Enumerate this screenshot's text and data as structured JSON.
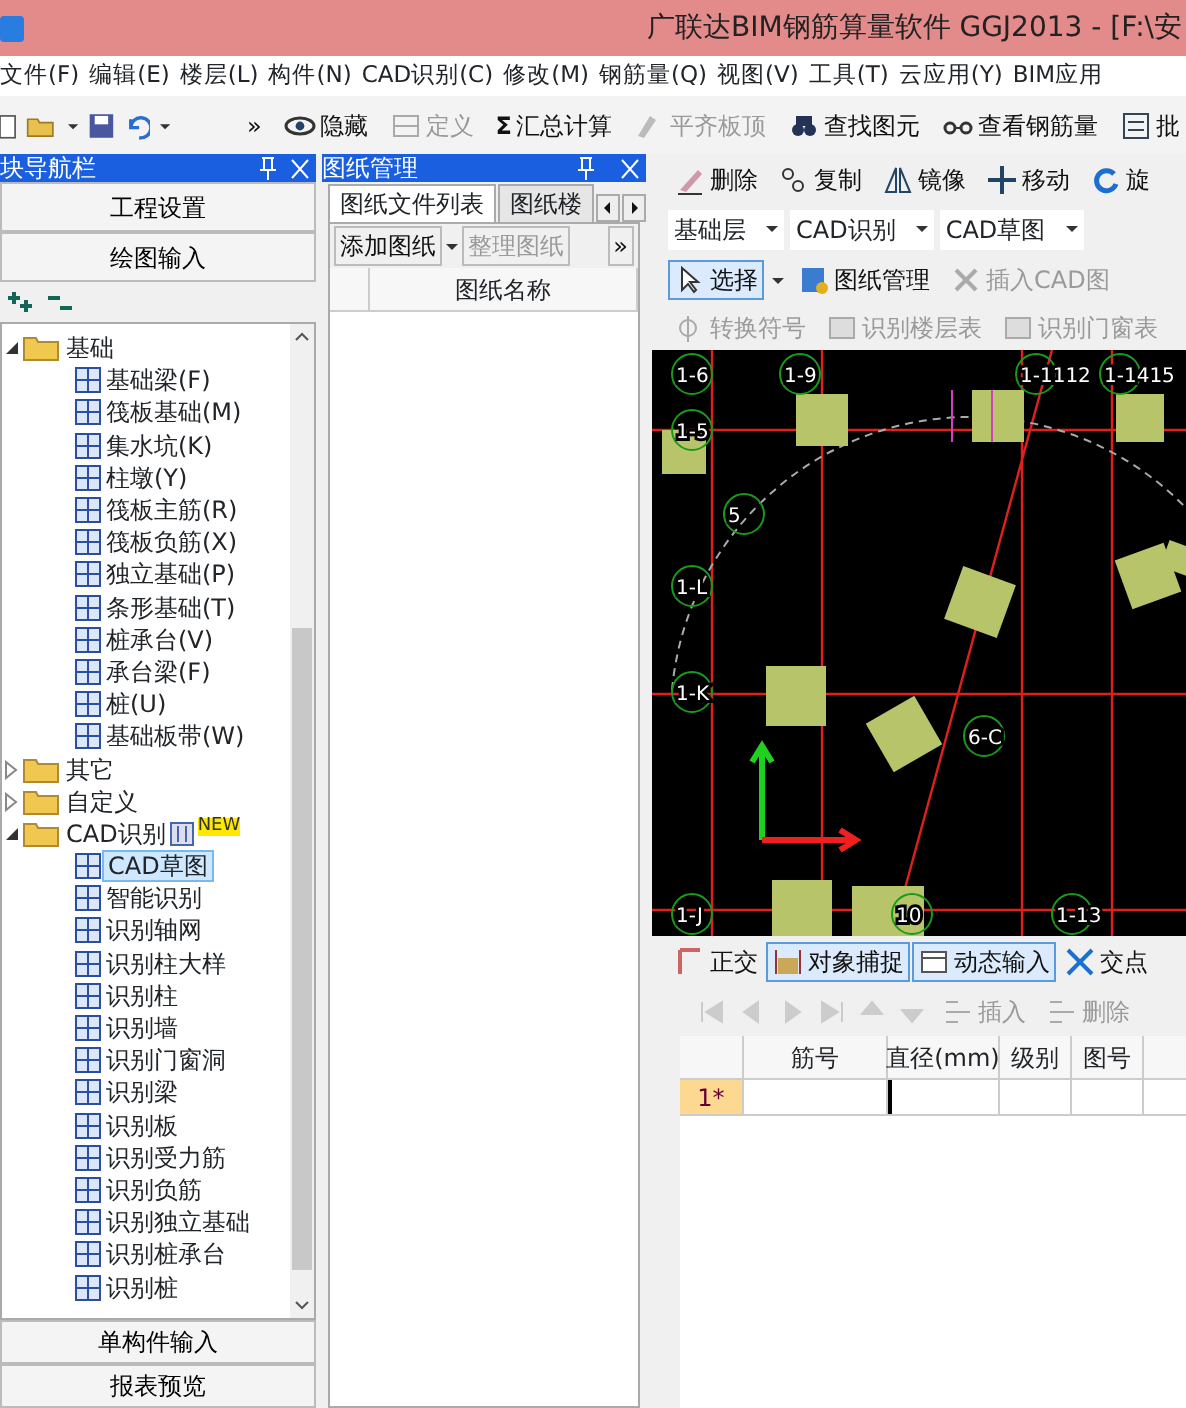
{
  "window": {
    "title": "广联达BIM钢筋算量软件 GGJ2013 - [F:\\安"
  },
  "menu": [
    "文件(F)",
    "编辑(E)",
    "楼层(L)",
    "构件(N)",
    "CAD识别(C)",
    "修改(M)",
    "钢筋量(Q)",
    "视图(V)",
    "工具(T)",
    "云应用(Y)",
    "BIM应用"
  ],
  "toolbar": {
    "overflow": "»",
    "items": [
      {
        "label": "隐藏",
        "disabled": false
      },
      {
        "label": "定义",
        "disabled": true
      },
      {
        "label": "汇总计算",
        "symbol": "Σ",
        "disabled": false
      },
      {
        "label": "平齐板顶",
        "disabled": true
      },
      {
        "label": "查找图元",
        "disabled": false
      },
      {
        "label": "查看钢筋量",
        "disabled": false
      },
      {
        "label": "批",
        "disabled": false
      }
    ]
  },
  "navigator": {
    "title": "块导航栏",
    "top_buttons": [
      "工程设置",
      "绘图输入"
    ],
    "tree": [
      {
        "label": "基础",
        "expanded": true,
        "children": [
          {
            "label": "基础梁(F)",
            "selected": false
          },
          {
            "label": "筏板基础(M)",
            "selected": false
          },
          {
            "label": "集水坑(K)",
            "selected": false
          },
          {
            "label": "柱墩(Y)",
            "selected": false
          },
          {
            "label": "筏板主筋(R)",
            "selected": false
          },
          {
            "label": "筏板负筋(X)",
            "selected": false
          },
          {
            "label": "独立基础(P)",
            "selected": false
          },
          {
            "label": "条形基础(T)",
            "selected": false
          },
          {
            "label": "桩承台(V)",
            "selected": false
          },
          {
            "label": "承台梁(F)",
            "selected": false
          },
          {
            "label": "桩(U)",
            "selected": false
          },
          {
            "label": "基础板带(W)",
            "selected": false
          }
        ]
      },
      {
        "label": "其它",
        "expanded": false
      },
      {
        "label": "自定义",
        "expanded": false
      },
      {
        "label": "CAD识别",
        "expanded": true,
        "badge": "NEW",
        "children": [
          {
            "label": "CAD草图",
            "selected": true
          },
          {
            "label": "智能识别",
            "selected": false
          },
          {
            "label": "识别轴网",
            "selected": false
          },
          {
            "label": "识别柱大样",
            "selected": false
          },
          {
            "label": "识别柱",
            "selected": false
          },
          {
            "label": "识别墙",
            "selected": false
          },
          {
            "label": "识别门窗洞",
            "selected": false
          },
          {
            "label": "识别梁",
            "selected": false
          },
          {
            "label": "识别板",
            "selected": false
          },
          {
            "label": "识别受力筋",
            "selected": false
          },
          {
            "label": "识别负筋",
            "selected": false
          },
          {
            "label": "识别独立基础",
            "selected": false
          },
          {
            "label": "识别桩承台",
            "selected": false
          },
          {
            "label": "识别桩",
            "selected": false
          }
        ]
      }
    ],
    "bottom_buttons": [
      "单构件输入",
      "报表预览"
    ]
  },
  "drawing_manager": {
    "title": "图纸管理",
    "tabs": [
      {
        "label": "图纸文件列表",
        "selected": true
      },
      {
        "label": "图纸楼",
        "selected": false
      }
    ],
    "buttons": [
      {
        "label": "添加图纸",
        "disabled": false
      },
      {
        "label": "整理图纸",
        "disabled": true
      }
    ],
    "overflow": "»",
    "columns": [
      "图纸名称"
    ]
  },
  "edit_toolbar": [
    "删除",
    "复制",
    "镜像",
    "移动",
    "旋"
  ],
  "selectors": [
    "基础层",
    "CAD识别",
    "CAD草图"
  ],
  "draw_toolbar": [
    {
      "label": "选择",
      "pressed": true,
      "disabled": false
    },
    {
      "label": "图纸管理",
      "pressed": false,
      "disabled": false
    },
    {
      "label": "插入CAD图",
      "pressed": false,
      "disabled": true
    }
  ],
  "cad_toolbar": [
    {
      "label": "转换符号",
      "disabled": true
    },
    {
      "label": "识别楼层表",
      "disabled": true
    },
    {
      "label": "识别门窗表",
      "disabled": true
    }
  ],
  "cad_labels": [
    "1-6",
    "1-9",
    "1-1112",
    "1-1415",
    "1-5",
    "1-L",
    "1-K",
    "1-J",
    "5",
    "6-C",
    "10",
    "1-13"
  ],
  "snap_toolbar": [
    {
      "label": "正交",
      "pressed": false
    },
    {
      "label": "对象捕捉",
      "pressed": true
    },
    {
      "label": "动态输入",
      "pressed": true
    },
    {
      "label": "交点",
      "pressed": false
    }
  ],
  "grid_toolbar": [
    {
      "label": "插入",
      "disabled": true
    },
    {
      "label": "删除",
      "disabled": true
    }
  ],
  "rebar_table": {
    "columns": [
      "筋号",
      "直径(mm)",
      "级别",
      "图号"
    ],
    "rows": [
      {
        "row_header": "1*"
      }
    ]
  }
}
